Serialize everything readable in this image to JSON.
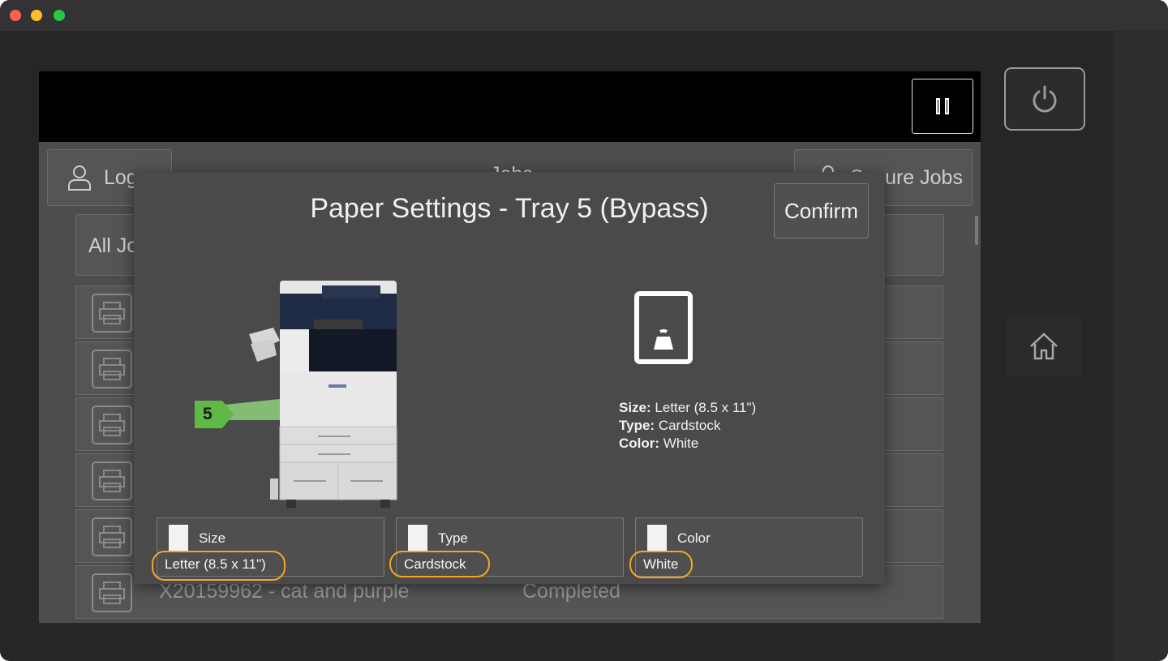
{
  "window": {
    "traffic_lights": [
      "close",
      "minimize",
      "zoom"
    ]
  },
  "device": {
    "power_icon": "power-icon",
    "home_icon": "home-icon",
    "pause_icon": "pause-icon"
  },
  "background": {
    "login_label": "Log",
    "jobs_label": "Jobs",
    "secure_jobs_label": "Secure Jobs",
    "all_jobs_label": "All Jo",
    "job_rows": [
      {
        "name": "",
        "status": ""
      },
      {
        "name": "",
        "status": ""
      },
      {
        "name": "",
        "status": ""
      },
      {
        "name": "",
        "status": ""
      },
      {
        "name": "",
        "status": ""
      },
      {
        "name": "X20159962 - cat and purple",
        "status": "Completed"
      }
    ]
  },
  "modal": {
    "title": "Paper Settings - Tray 5 (Bypass)",
    "confirm_label": "Confirm",
    "tray_number": "5",
    "info": {
      "size_label": "Size:",
      "size_value": "Letter (8.5 x 11\")",
      "type_label": "Type:",
      "type_value": "Cardstock",
      "color_label": "Color:",
      "color_value": "White"
    },
    "settings": [
      {
        "label": "Size",
        "value": "Letter (8.5 x 11\")"
      },
      {
        "label": "Type",
        "value": "Cardstock"
      },
      {
        "label": "Color",
        "value": "White"
      }
    ]
  },
  "colors": {
    "highlight": "#f5a623",
    "tray_tag": "#5fb946"
  }
}
